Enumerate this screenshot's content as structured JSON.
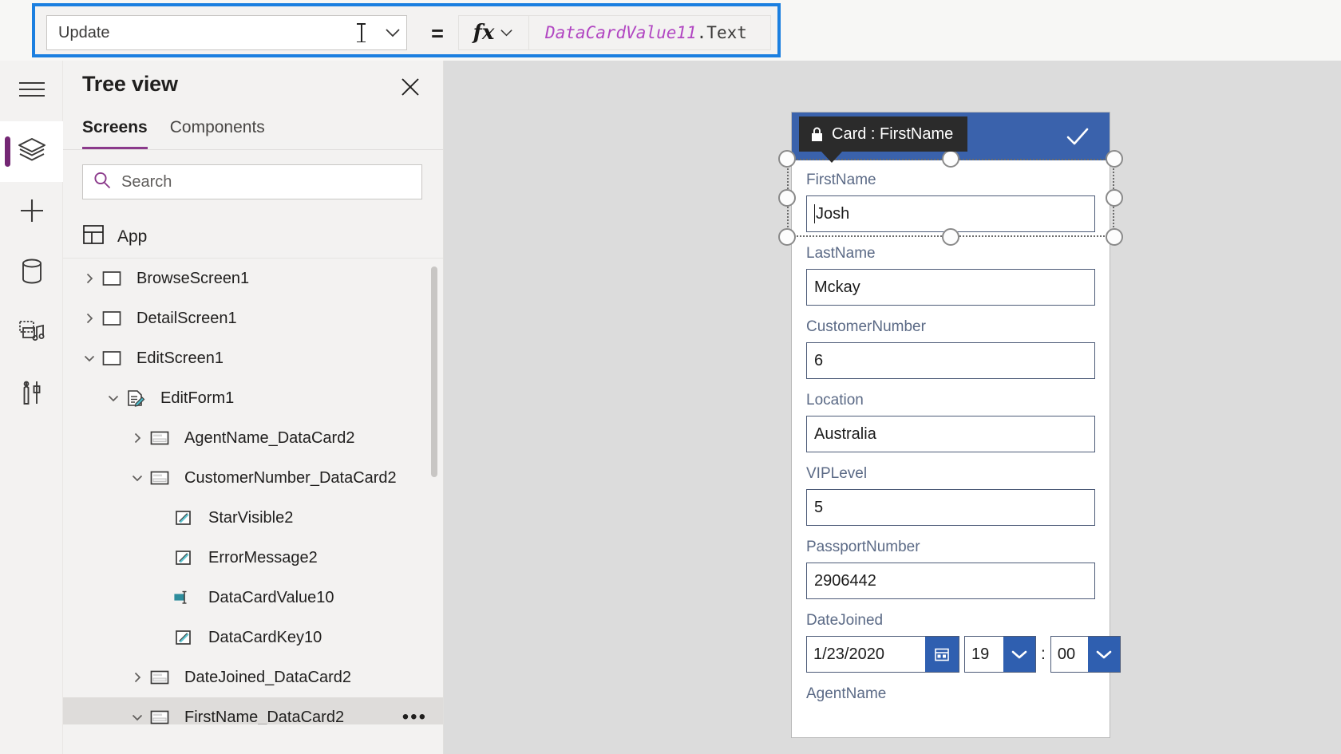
{
  "formula_bar": {
    "property_value": "Update",
    "equals": "=",
    "fx_label": "fx",
    "formula_identifier": "DataCardValue11",
    "formula_property": ".Text"
  },
  "rail": {
    "items": [
      {
        "name": "hamburger-menu",
        "icon": "hamburger-icon",
        "active": false
      },
      {
        "name": "tree-view",
        "icon": "layers-icon",
        "active": true
      },
      {
        "name": "insert",
        "icon": "plus-icon",
        "active": false
      },
      {
        "name": "data",
        "icon": "database-icon",
        "active": false
      },
      {
        "name": "media",
        "icon": "media-icon",
        "active": false
      },
      {
        "name": "advanced-tools",
        "icon": "tools-icon",
        "active": false
      }
    ],
    "accent": "#742774"
  },
  "treeview": {
    "title": "Tree view",
    "close_label": "Close",
    "tabs": [
      {
        "label": "Screens",
        "selected": true
      },
      {
        "label": "Components",
        "selected": false
      }
    ],
    "search": {
      "placeholder": "Search",
      "value": ""
    },
    "app_row": {
      "label": "App",
      "icon": "app-icon"
    },
    "nodes": [
      {
        "label": "BrowseScreen1",
        "indent": 0,
        "twisty": "collapsed",
        "icon": "screen-icon",
        "selected": false
      },
      {
        "label": "DetailScreen1",
        "indent": 0,
        "twisty": "collapsed",
        "icon": "screen-icon",
        "selected": false
      },
      {
        "label": "EditScreen1",
        "indent": 0,
        "twisty": "expanded",
        "icon": "screen-icon",
        "selected": false
      },
      {
        "label": "EditForm1",
        "indent": 1,
        "twisty": "expanded",
        "icon": "form-icon",
        "selected": false
      },
      {
        "label": "AgentName_DataCard2",
        "indent": 2,
        "twisty": "collapsed",
        "icon": "card-icon",
        "selected": false
      },
      {
        "label": "CustomerNumber_DataCard2",
        "indent": 2,
        "twisty": "expanded",
        "icon": "card-icon",
        "selected": false
      },
      {
        "label": "StarVisible2",
        "indent": 3,
        "twisty": "none",
        "icon": "label-icon",
        "selected": false
      },
      {
        "label": "ErrorMessage2",
        "indent": 3,
        "twisty": "none",
        "icon": "label-icon",
        "selected": false
      },
      {
        "label": "DataCardValue10",
        "indent": 3,
        "twisty": "none",
        "icon": "textinput-icon",
        "selected": false
      },
      {
        "label": "DataCardKey10",
        "indent": 3,
        "twisty": "none",
        "icon": "label-icon",
        "selected": false
      },
      {
        "label": "DateJoined_DataCard2",
        "indent": 2,
        "twisty": "collapsed",
        "icon": "card-icon",
        "selected": false
      },
      {
        "label": "FirstName_DataCard2",
        "indent": 2,
        "twisty": "expanded",
        "icon": "card-icon",
        "selected": true,
        "ellipsis": "•••"
      }
    ]
  },
  "canvas": {
    "tooltip": {
      "text": "Card : FirstName",
      "icon": "lock-icon"
    },
    "form_header_color": "#3a62ac",
    "check_icon": "checkmark-icon",
    "fields": [
      {
        "label": "FirstName",
        "value": "Josh",
        "type": "text"
      },
      {
        "label": "LastName",
        "value": "Mckay",
        "type": "text"
      },
      {
        "label": "CustomerNumber",
        "value": "6",
        "type": "text"
      },
      {
        "label": "Location",
        "value": "Australia",
        "type": "text"
      },
      {
        "label": "VIPLevel",
        "value": "5",
        "type": "text"
      },
      {
        "label": "PassportNumber",
        "value": "2906442",
        "type": "text"
      }
    ],
    "date_field": {
      "label": "DateJoined",
      "date_value": "1/23/2020",
      "hour_value": "19",
      "separator": ":",
      "minute_value": "00",
      "calendar_icon": "calendar-icon",
      "dropdown_icon": "chevron-down-icon"
    },
    "cut_off_label": "AgentName"
  }
}
